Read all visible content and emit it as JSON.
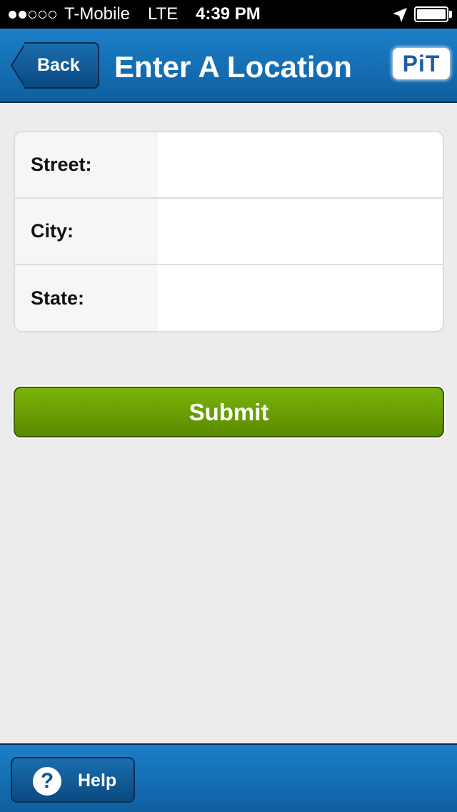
{
  "status_bar": {
    "signal_bars_filled": 2,
    "signal_bars_total": 5,
    "carrier": "T-Mobile",
    "network": "LTE",
    "time": "4:39 PM",
    "battery_level": 1.0
  },
  "nav": {
    "back_label": "Back",
    "title": "Enter A Location",
    "logo_text": "PiT"
  },
  "form": {
    "fields": [
      {
        "label": "Street:",
        "value": ""
      },
      {
        "label": "City:",
        "value": ""
      },
      {
        "label": "State:",
        "value": ""
      }
    ],
    "submit_label": "Submit"
  },
  "bottom_bar": {
    "help_label": "Help",
    "help_icon_glyph": "?"
  },
  "colors": {
    "nav_blue": "#1c7fc8",
    "submit_green": "#79b40a",
    "background": "#ececec"
  }
}
